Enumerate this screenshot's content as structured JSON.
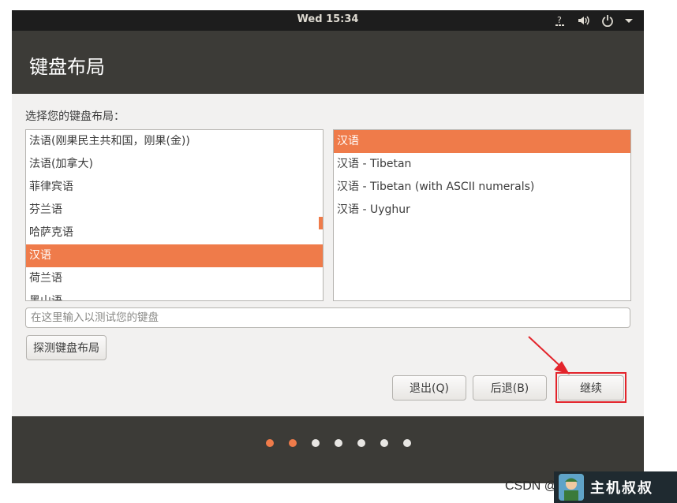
{
  "topbar": {
    "clock": "Wed 15:34",
    "icons": [
      "accessibility-icon",
      "volume-icon",
      "power-icon",
      "chevron-down-icon"
    ]
  },
  "window": {
    "title": "键盘布局"
  },
  "content": {
    "prompt": "选择您的键盘布局：",
    "layouts": [
      "法语(刚果民主共和国，刚果(金))",
      "法语(加拿大)",
      "菲律宾语",
      "芬兰语",
      "哈萨克语",
      "汉语",
      "荷兰语",
      "黑山语"
    ],
    "selected_layout": "汉语",
    "variants": [
      "汉语",
      "汉语 - Tibetan",
      "汉语 - Tibetan (with ASCII numerals)",
      "汉语 - Uyghur"
    ],
    "selected_variant": "汉语",
    "test_input": {
      "placeholder": "在这里输入以测试您的键盘",
      "value": ""
    },
    "detect_label": "探测键盘布局"
  },
  "buttons": {
    "quit": "退出(Q)",
    "back": "后退(B)",
    "continue": "继续"
  },
  "progress": {
    "total_steps": 7,
    "current_step": 2
  },
  "watermark": {
    "text": "CSDN @",
    "badge_text": "主机叔叔"
  },
  "colors": {
    "accent": "#ef7b4a",
    "annotation": "#e3242b",
    "topbar": "#1d1d1d",
    "window_bg": "#3c3b37"
  }
}
